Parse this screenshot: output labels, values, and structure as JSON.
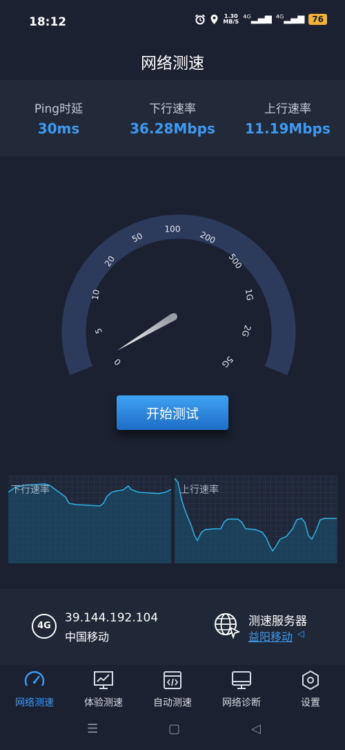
{
  "status_bar": {
    "time": "18:12",
    "net_speed_value": "1.30",
    "net_speed_unit": "MB/S",
    "signal_1": "⁴ᴳ",
    "signal_2": "⁴ᴳ",
    "battery": "76"
  },
  "header": {
    "title": "网络测速"
  },
  "stats": {
    "ping_label": "Ping时延",
    "ping_value": "30ms",
    "down_label": "下行速率",
    "down_value": "36.28Mbps",
    "up_label": "上行速率",
    "up_value": "11.19Mbps"
  },
  "gauge": {
    "ticks": [
      "0",
      "5",
      "10",
      "20",
      "50",
      "100",
      "200",
      "500",
      "1G",
      "2G",
      "5G"
    ],
    "needle_value": "5"
  },
  "start_button": {
    "label": "开始测试"
  },
  "graphs": {
    "download_label": "下行速率",
    "upload_label": "上行速率"
  },
  "network": {
    "badge": "4G",
    "ip": "39.144.192.104",
    "isp": "中国移动",
    "server_label": "测速服务器",
    "server_name": "益阳移动"
  },
  "nav": {
    "items": [
      {
        "label": "网络测速",
        "icon": "speedometer-icon"
      },
      {
        "label": "体验测速",
        "icon": "monitor-chart-icon"
      },
      {
        "label": "自动测速",
        "icon": "code-window-icon"
      },
      {
        "label": "网络诊断",
        "icon": "desktop-icon"
      },
      {
        "label": "设置",
        "icon": "hexagon-settings-icon"
      }
    ]
  },
  "colors": {
    "background": "#1b2130",
    "accent": "#3d9af0",
    "gauge_track": "#2c3a5c",
    "chart_line": "#2fb4e8"
  }
}
